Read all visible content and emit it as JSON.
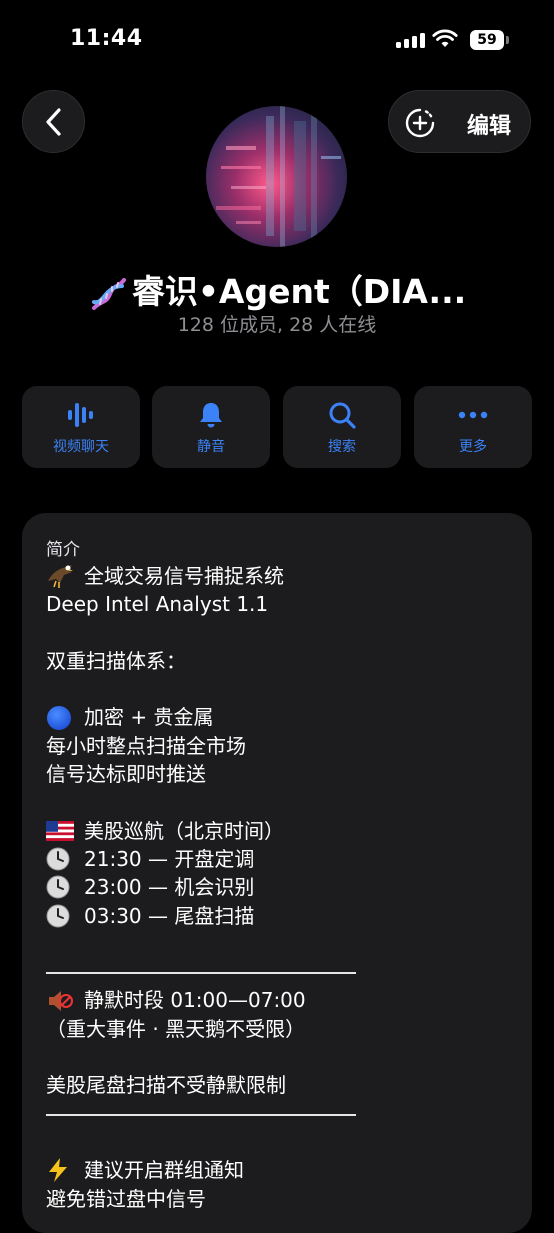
{
  "status_bar": {
    "time": "11:44",
    "battery": "59"
  },
  "header": {
    "edit_label": "编辑",
    "group_name": "睿识•Agent（DIA...",
    "members_text": "128 位成员, 28 人在线"
  },
  "actions": [
    {
      "label": "视频聊天",
      "icon": "waveform-icon"
    },
    {
      "label": "静音",
      "icon": "bell-icon"
    },
    {
      "label": "搜索",
      "icon": "search-icon"
    },
    {
      "label": "更多",
      "icon": "more-dots-icon"
    }
  ],
  "intro": {
    "heading": "简介",
    "lines": [
      {
        "emoji": "eagle",
        "text": "全域交易信号捕捉系统"
      },
      {
        "emoji": "",
        "text": "Deep Intel Analyst 1.1"
      },
      {
        "emoji": "",
        "text": ""
      },
      {
        "emoji": "",
        "text": "双重扫描体系："
      },
      {
        "emoji": "",
        "text": ""
      },
      {
        "emoji": "blue-circle",
        "text": "加密 + 贵金属"
      },
      {
        "emoji": "",
        "text": "每小时整点扫描全市场"
      },
      {
        "emoji": "",
        "text": "信号达标即时推送"
      },
      {
        "emoji": "",
        "text": ""
      },
      {
        "emoji": "us-flag",
        "text": "美股巡航（北京时间）"
      },
      {
        "emoji": "clock",
        "text": "21:30 — 开盘定调"
      },
      {
        "emoji": "clock",
        "text": "23:00 — 机会识别"
      },
      {
        "emoji": "clock",
        "text": "03:30 — 尾盘扫描"
      },
      {
        "emoji": "",
        "text": ""
      },
      {
        "emoji": "rule",
        "text": ""
      },
      {
        "emoji": "muted-speaker",
        "text": "静默时段 01:00—07:00"
      },
      {
        "emoji": "",
        "text": "（重大事件 · 黑天鹅不受限）"
      },
      {
        "emoji": "",
        "text": ""
      },
      {
        "emoji": "",
        "text": "美股尾盘扫描不受静默限制"
      },
      {
        "emoji": "rule",
        "text": ""
      },
      {
        "emoji": "",
        "text": ""
      },
      {
        "emoji": "lightning",
        "text": "建议开启群组通知"
      },
      {
        "emoji": "",
        "text": "避免错过盘中信号"
      }
    ]
  },
  "colors": {
    "accent": "#3b82f6",
    "card": "#1c1c1e",
    "secondary_text": "#8e8e93"
  }
}
